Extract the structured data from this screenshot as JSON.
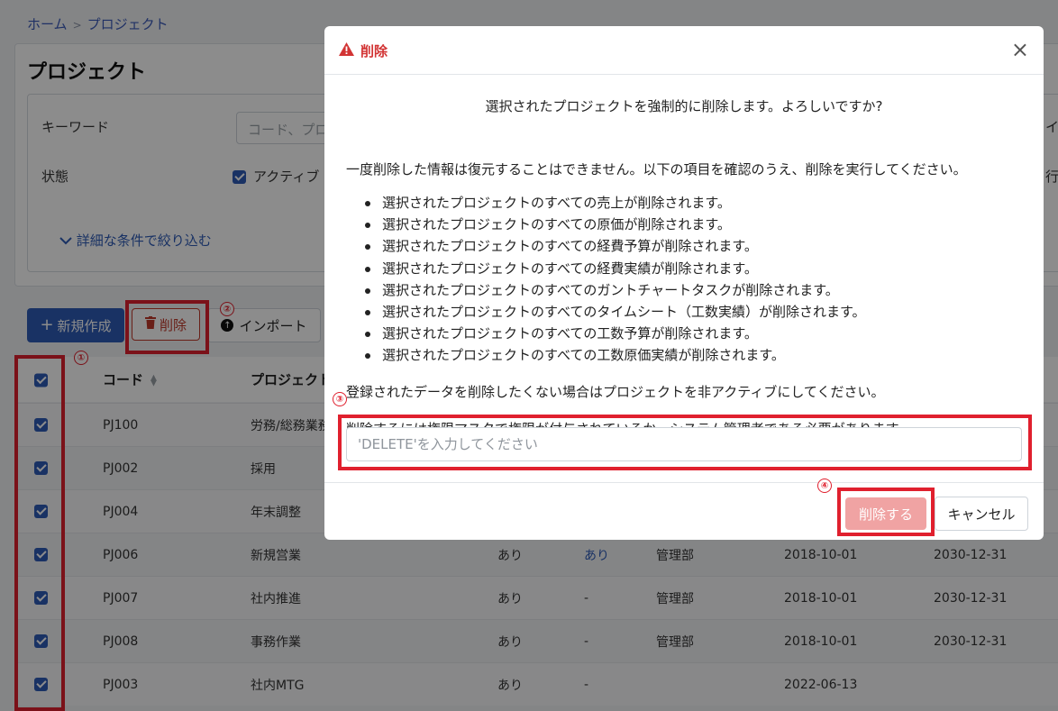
{
  "breadcrumb": [
    "ホーム",
    "プロジェクト"
  ],
  "page": {
    "title": "プロジェクト",
    "filter": {
      "keyword_label": "キーワード",
      "keyword_placeholder": "コード、プロ",
      "status_label": "状態",
      "active_label": "アクティブ",
      "detail_link": "詳細な条件で絞り込む",
      "right_cut_1": "イ",
      "right_cut_2": "行"
    },
    "toolbar": {
      "new_label": "新規作成",
      "delete_label": "削除",
      "import_label": "インポート"
    },
    "table": {
      "headers": {
        "code": "コード",
        "project": "プロジェクト"
      },
      "rows": [
        {
          "code": "PJ100",
          "name": "労務/総務業務",
          "c3": "",
          "c4": "",
          "dept": "",
          "start": "",
          "end": ""
        },
        {
          "code": "PJ002",
          "name": "採用",
          "c3": "",
          "c4": "",
          "dept": "",
          "start": "",
          "end": ""
        },
        {
          "code": "PJ004",
          "name": "年末調整",
          "c3": "",
          "c4": "",
          "dept": "",
          "start": "",
          "end": ""
        },
        {
          "code": "PJ006",
          "name": "新規営業",
          "c3": "あり",
          "c4": "あり",
          "dept": "管理部",
          "start": "2018-10-01",
          "end": "2030-12-31"
        },
        {
          "code": "PJ007",
          "name": "社内推進",
          "c3": "あり",
          "c4": "-",
          "dept": "管理部",
          "start": "2018-10-01",
          "end": "2030-12-31"
        },
        {
          "code": "PJ008",
          "name": "事務作業",
          "c3": "あり",
          "c4": "-",
          "dept": "管理部",
          "start": "2018-10-01",
          "end": "2030-12-31"
        },
        {
          "code": "PJ003",
          "name": "社内MTG",
          "c3": "あり",
          "c4": "-",
          "dept": "",
          "start": "2022-06-13",
          "end": ""
        }
      ]
    }
  },
  "annotations": {
    "n1": "①",
    "n2": "②",
    "n3": "③",
    "n4": "④"
  },
  "modal": {
    "title": "削除",
    "close_symbol": "×",
    "question": "選択されたプロジェクトを強制的に削除します。よろしいですか?",
    "intro": "一度削除した情報は復元することはできません。以下の項目を確認のうえ、削除を実行してください。",
    "items": [
      "選択されたプロジェクトのすべての売上が削除されます。",
      "選択されたプロジェクトのすべての原価が削除されます。",
      "選択されたプロジェクトのすべての経費予算が削除されます。",
      "選択されたプロジェクトのすべての経費実績が削除されます。",
      "選択されたプロジェクトのすべてのガントチャートタスクが削除されます。",
      "選択されたプロジェクトのすべてのタイムシート（工数実績）が削除されます。",
      "選択されたプロジェクトのすべての工数予算が削除されます。",
      "選択されたプロジェクトのすべての工数原価実績が削除されます。"
    ],
    "note_inactive": "登録されたデータを削除したくない場合はプロジェクトを非アクティブにしてください。",
    "note_permission": "削除するには権限マスタで権限が付与されているか、システム管理者である必要があります。",
    "input_placeholder": "'DELETE'を入力してください",
    "input_value": "",
    "confirm_label": "削除する",
    "cancel_label": "キャンセル"
  },
  "colors": {
    "danger": "#d23434",
    "primary": "#2f5bb7",
    "annotation": "#e0202e"
  },
  "icons": {
    "warning": "warning-icon",
    "trash": "trash-icon",
    "plus": "plus-icon",
    "upload": "upload-icon",
    "close": "close-icon"
  }
}
